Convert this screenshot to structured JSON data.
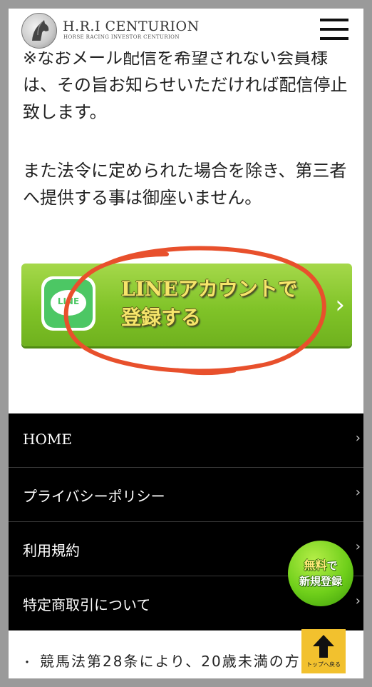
{
  "header": {
    "logo_title": "H.R.I CENTURION",
    "logo_subtitle": "HORSE RACING INVESTOR CENTURION"
  },
  "content": {
    "paragraph_1": "※なおメール配信を希望されない会員様は、その旨お知らせいただければ配信停止致します。",
    "paragraph_2": "また法令に定められた場合を除き、第三者へ提供する事は御座いません。"
  },
  "line_button": {
    "logo_text": "LINE",
    "label": "LINEアカウントで\n登録する",
    "arrow": "›"
  },
  "footer_menu": {
    "items": [
      {
        "label": "HOME"
      },
      {
        "label": "プライバシーポリシー"
      },
      {
        "label": "利用規約"
      },
      {
        "label": "特定商取引について"
      }
    ]
  },
  "notice": {
    "bullet": "・",
    "text": "競馬法第28条により、20歳未満の方"
  },
  "register_badge": {
    "line1": "無料",
    "line1_suffix": "で",
    "line2": "新規登録"
  },
  "top_button": {
    "label": "トップへ戻る"
  },
  "colors": {
    "accent_green": "#80c328",
    "line_green": "#4cc764",
    "annotation_red": "#e8502c",
    "footer_bg": "#000000",
    "top_button": "#f2c12e"
  }
}
